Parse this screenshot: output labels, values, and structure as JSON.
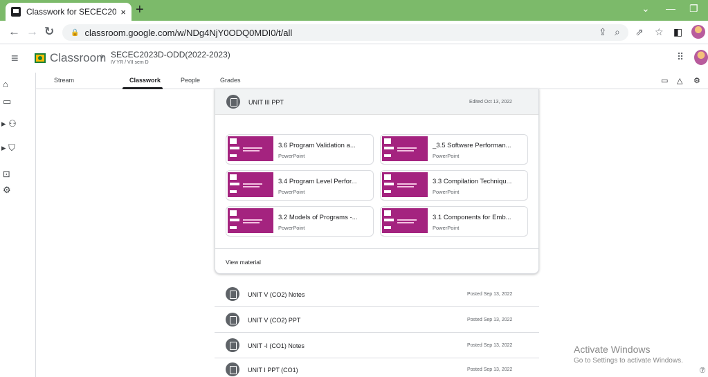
{
  "browser": {
    "tab_title": "Classwork for SECEC2023D-ODD(",
    "tab_close": "×",
    "new_tab": "+",
    "url": "classroom.google.com/w/NDg4NjY0ODQ0MDI0/t/all"
  },
  "header": {
    "app_title": "Classroom",
    "class_name": "SECEC2023D-ODD(2022-2023)",
    "class_subtitle": "IV YR / VII sem D"
  },
  "tabs": [
    {
      "label": "Stream"
    },
    {
      "label": "Classwork"
    },
    {
      "label": "People"
    },
    {
      "label": "Grades"
    }
  ],
  "expanded_topic": {
    "title": "UNIT III PPT",
    "date": "Edited Oct 13, 2022",
    "view_label": "View material",
    "attachments": [
      {
        "title": "3.6 Program Validation a...",
        "type": "PowerPoint"
      },
      {
        "title": "_3.5 Software Performan...",
        "type": "PowerPoint"
      },
      {
        "title": "3.4 Program Level Perfor...",
        "type": "PowerPoint"
      },
      {
        "title": "3.3 Compilation Techniqu...",
        "type": "PowerPoint"
      },
      {
        "title": "3.2 Models of Programs -...",
        "type": "PowerPoint"
      },
      {
        "title": "3.1 Components for Emb...",
        "type": "PowerPoint"
      }
    ]
  },
  "topics": [
    {
      "title": "UNIT V (CO2) Notes",
      "date": "Posted Sep 13, 2022"
    },
    {
      "title": "UNIT V (CO2) PPT",
      "date": "Posted Sep 13, 2022"
    },
    {
      "title": "UNIT -I (CO1) Notes",
      "date": "Posted Sep 13, 2022"
    },
    {
      "title": "UNIT I PPT (CO1)",
      "date": "Posted Sep 13, 2022"
    }
  ],
  "watermark": {
    "line1": "Activate Windows",
    "line2": "Go to Settings to activate Windows."
  },
  "colors": {
    "tab_strip": "#7cba6a",
    "thumb": "#a4237f"
  }
}
